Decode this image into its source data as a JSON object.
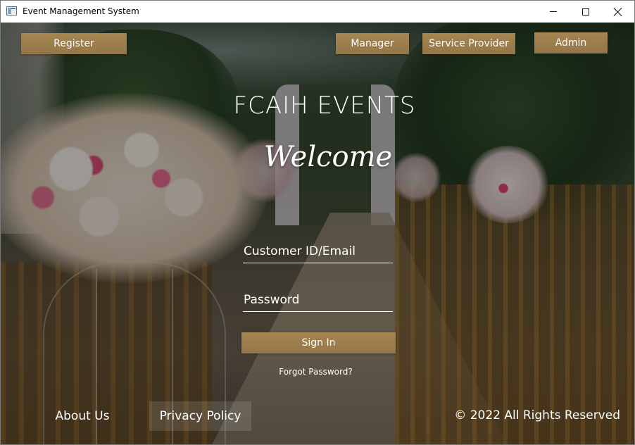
{
  "window": {
    "title": "Event Management System"
  },
  "nav": {
    "register_label": "Register",
    "manager_label": "Manager",
    "service_provider_label": "Service Provider",
    "admin_label": "Admin"
  },
  "hero": {
    "brand": "FCAIH EVENTS",
    "welcome": "Welcome"
  },
  "login": {
    "id_placeholder": "Customer ID/Email",
    "id_value": "",
    "password_placeholder": "Password",
    "password_value": "",
    "signin_label": "Sign In",
    "forgot_label": "Forgot Password?"
  },
  "footer": {
    "about_label": "About Us",
    "privacy_label": "Privacy Policy",
    "copyright": "© 2022 All Rights Reserved"
  },
  "colors": {
    "button_gold": "#a58650",
    "text": "#ffffff"
  }
}
